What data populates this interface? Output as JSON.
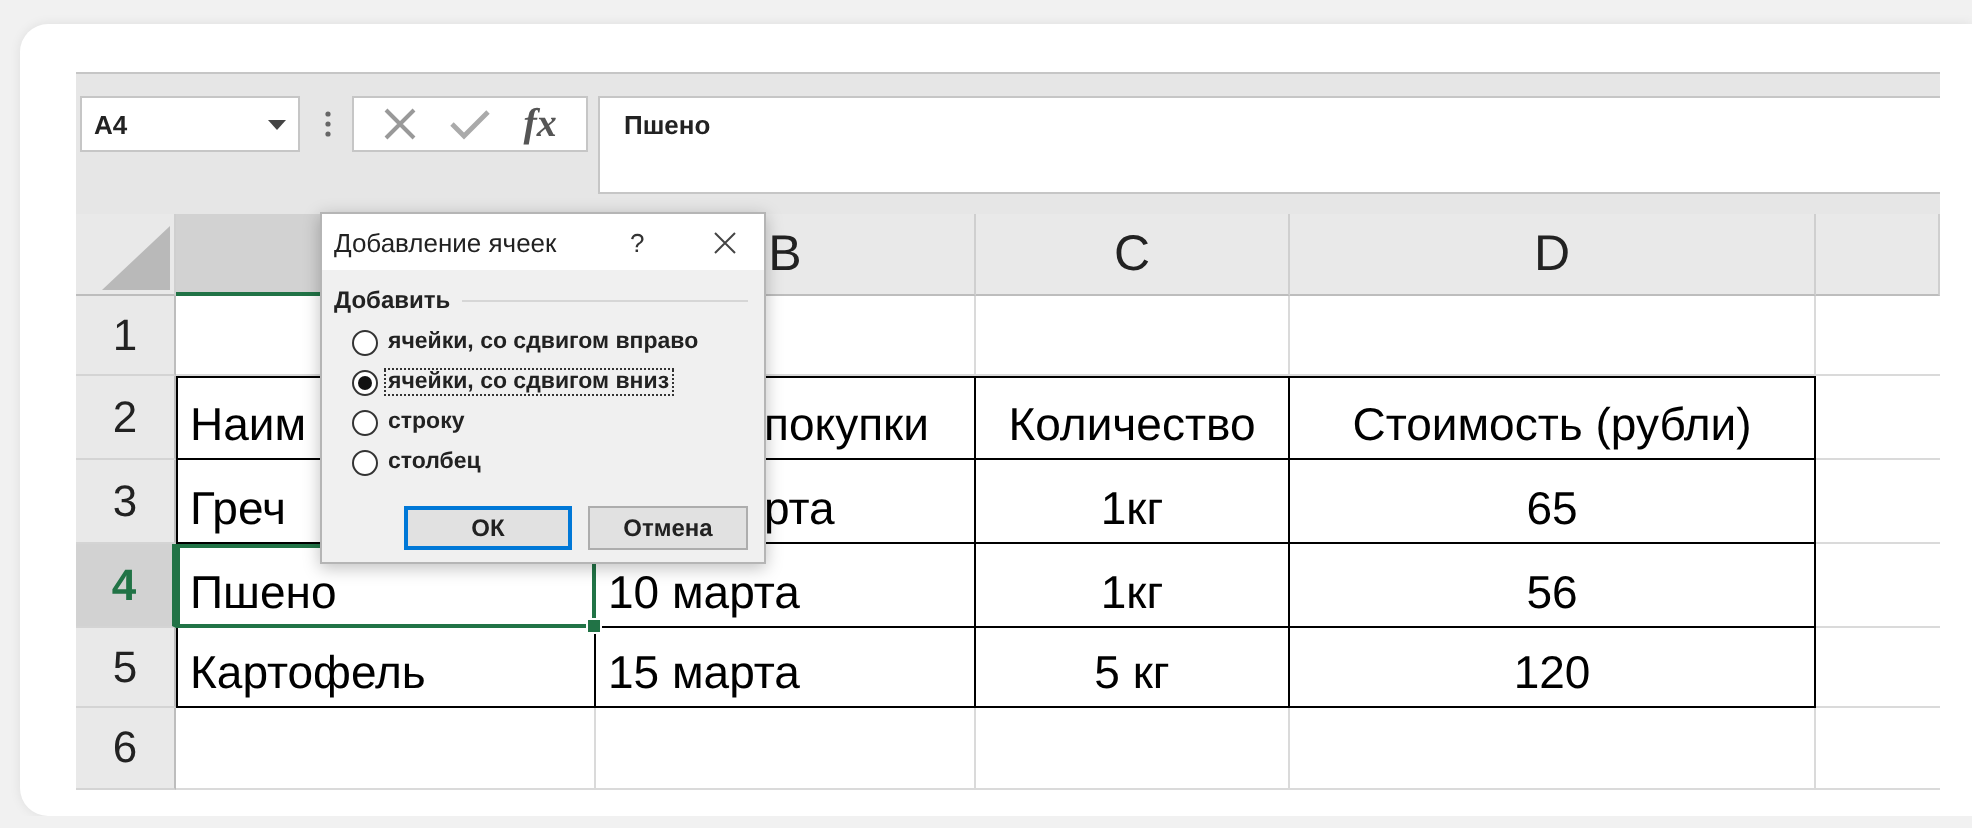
{
  "formula_bar": {
    "name_box": "A4",
    "fx": "fx",
    "formula": "Пшено"
  },
  "sheet": {
    "columns": [
      {
        "selected": true
      },
      {
        "label": "B",
        "selected": false
      },
      {
        "label": "C",
        "selected": false
      },
      {
        "label": "D",
        "selected": false
      }
    ],
    "rows": [
      {
        "label": "1",
        "selected": false,
        "bordered": false,
        "cells": [
          {
            "active": false
          },
          {
            "active": false
          },
          {
            "active": false
          },
          {
            "active": false
          }
        ]
      },
      {
        "label": "2",
        "selected": false,
        "bordered": true,
        "cells": [
          {
            "text": "Наим",
            "active": false
          },
          {
            "text": "покупки",
            "active": false
          },
          {
            "text": "Количество",
            "active": false
          },
          {
            "text": "Стоимость (рубли)",
            "active": false
          }
        ]
      },
      {
        "label": "3",
        "selected": false,
        "bordered": true,
        "cells": [
          {
            "text": "Греч",
            "active": false
          },
          {
            "text": "рта",
            "active": false
          },
          {
            "text": "1кг",
            "active": false
          },
          {
            "text": "65",
            "active": false
          }
        ]
      },
      {
        "label": "4",
        "selected": true,
        "bordered": true,
        "cells": [
          {
            "text": "Пшено",
            "active": true
          },
          {
            "text": "10 марта",
            "active": false
          },
          {
            "text": "1кг",
            "active": false
          },
          {
            "text": "56",
            "active": false
          }
        ]
      },
      {
        "label": "5",
        "selected": false,
        "bordered": true,
        "cells": [
          {
            "text": "Картофель",
            "active": false
          },
          {
            "text": "15 марта",
            "active": false
          },
          {
            "text": "5 кг",
            "active": false
          },
          {
            "text": "120",
            "active": false
          }
        ]
      },
      {
        "label": "6",
        "selected": false,
        "bordered": false,
        "cells": [
          {
            "active": false
          },
          {
            "active": false
          },
          {
            "active": false
          },
          {
            "active": false
          }
        ]
      }
    ]
  },
  "dialog": {
    "title": "Добавление ячеек",
    "help": "?",
    "group_label": "Добавить",
    "options": [
      {
        "label": "ячейки, со сдвигом вправо",
        "selected": false,
        "focused": false
      },
      {
        "label": "ячейки, со сдвигом вниз",
        "selected": true,
        "focused": true
      },
      {
        "label": "строку",
        "selected": false,
        "focused": false
      },
      {
        "label": "столбец",
        "selected": false,
        "focused": false
      }
    ],
    "buttons": [
      {
        "label": "ОК",
        "default": true
      },
      {
        "label": "Отмена",
        "default": false
      }
    ]
  }
}
